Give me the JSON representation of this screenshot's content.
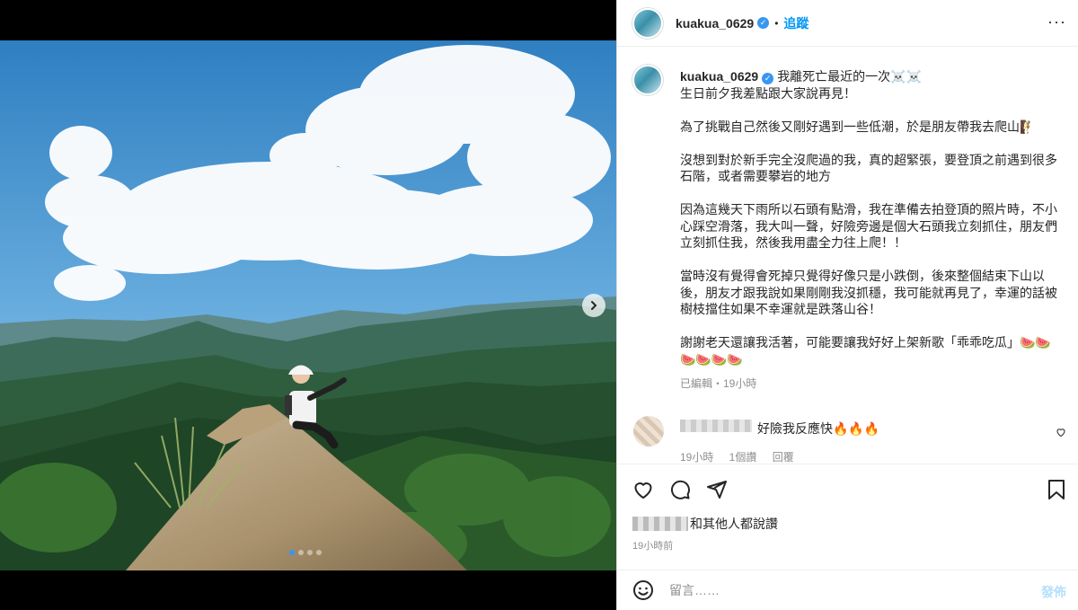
{
  "post": {
    "username": "kuakua_0629",
    "follow_label": "追蹤",
    "dot": "•",
    "more_icon": "more-horizontal-icon"
  },
  "caption": {
    "first_line": "我離死亡最近的一次☠️☠️",
    "paragraphs": [
      "生日前夕我差點跟大家說再見！",
      "",
      "為了挑戰自己然後又剛好遇到一些低潮，於是朋友帶我去爬山🧗",
      "",
      "沒想到對於新手完全沒爬過的我，真的超緊張，要登頂之前遇到很多石階，或者需要攀岩的地方",
      "",
      "因為這幾天下雨所以石頭有點滑，我在準備去拍登頂的照片時，不小心踩空滑落，我大叫一聲，好險旁邊是個大石頭我立刻抓住，朋友們立刻抓住我，然後我用盡全力往上爬！！",
      "",
      "當時沒有覺得會死掉只覺得好像只是小跌倒，後來整個結束下山以後，朋友才跟我說如果剛剛我沒抓穩，我可能就再見了，幸運的話被樹枝擋住如果不幸運就是跌落山谷！",
      "",
      "謝謝老天還讓我活著，可能要讓我好好上架新歌「乖乖吃瓜」🍉🍉🍉🍉🍉🍉"
    ],
    "meta": "已編輯・19小時"
  },
  "comment": {
    "text": "好險我反應快🔥🔥🔥",
    "meta": "19小時 1個讚 回覆"
  },
  "likes": {
    "suffix": "和其他人都說讚"
  },
  "timestamp": "19小時前",
  "comment_input": {
    "placeholder": "留言……",
    "post_label": "發佈"
  },
  "colors": {
    "accent": "#0095f6",
    "verified": "#3897f0",
    "post_disabled": "#b2dffc",
    "muted_text": "#8e8e8e"
  },
  "carousel": {
    "current": 1,
    "total": 4
  }
}
